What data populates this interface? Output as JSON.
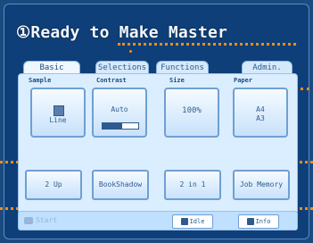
{
  "status": {
    "title": "①Ready to Make Master"
  },
  "tabs": [
    {
      "label": "Basic",
      "active": true
    },
    {
      "label": "Selections",
      "active": false
    },
    {
      "label": "Functions",
      "active": false
    },
    {
      "label": "Admin.",
      "active": false
    }
  ],
  "panel": {
    "columns": [
      {
        "label": "Sample"
      },
      {
        "label": "Contrast"
      },
      {
        "label": "Size"
      },
      {
        "label": "Paper"
      }
    ],
    "tiles": {
      "line_label": "Line",
      "auto_label": "Auto",
      "contrast_level": 0.55,
      "size_value": "100%",
      "paper_line1": "A4",
      "paper_line2": "A3"
    },
    "buttons": {
      "two_up": "2 Up",
      "book_shadow": "BookShadow",
      "two_in_one": "2 in 1",
      "job_memory": "Job Memory"
    }
  },
  "footer": {
    "start": "Start",
    "idle": "Idle",
    "info": "Info"
  },
  "colors": {
    "annotation": "#ff8a1a",
    "panel_bg": "#dbeeff",
    "frame_bg": "#0f3f78"
  }
}
